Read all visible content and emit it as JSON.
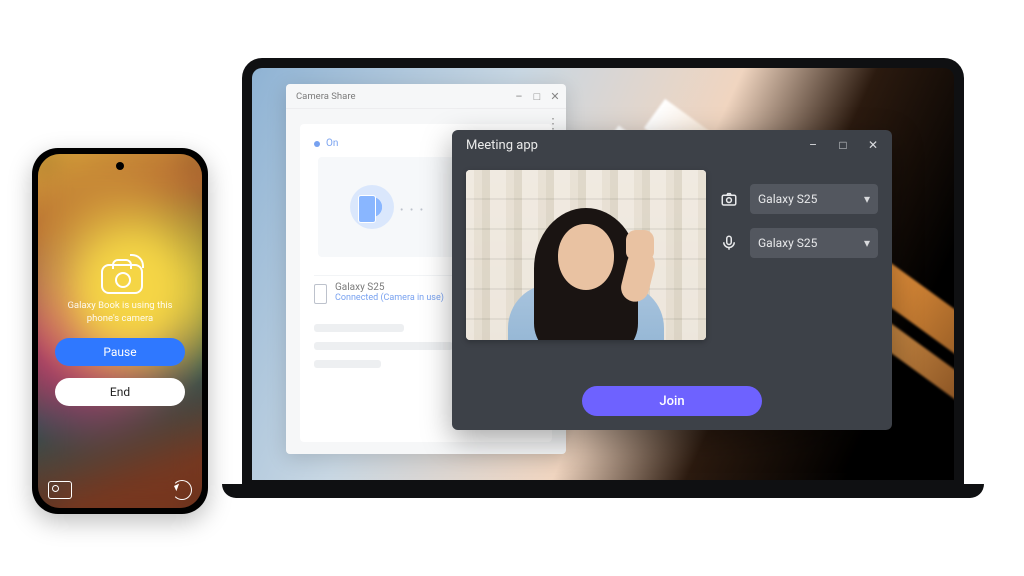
{
  "laptop": {
    "camera_share": {
      "title": "Camera Share",
      "status_label": "On",
      "device": {
        "name": "Galaxy S25",
        "status": "Connected (Camera in use)"
      }
    },
    "meeting_app": {
      "title": "Meeting app",
      "camera_select": "Galaxy S25",
      "mic_select": "Galaxy S25",
      "join_label": "Join"
    }
  },
  "phone": {
    "caption": "Galaxy Book is using this phone's camera",
    "pause_label": "Pause",
    "end_label": "End"
  }
}
